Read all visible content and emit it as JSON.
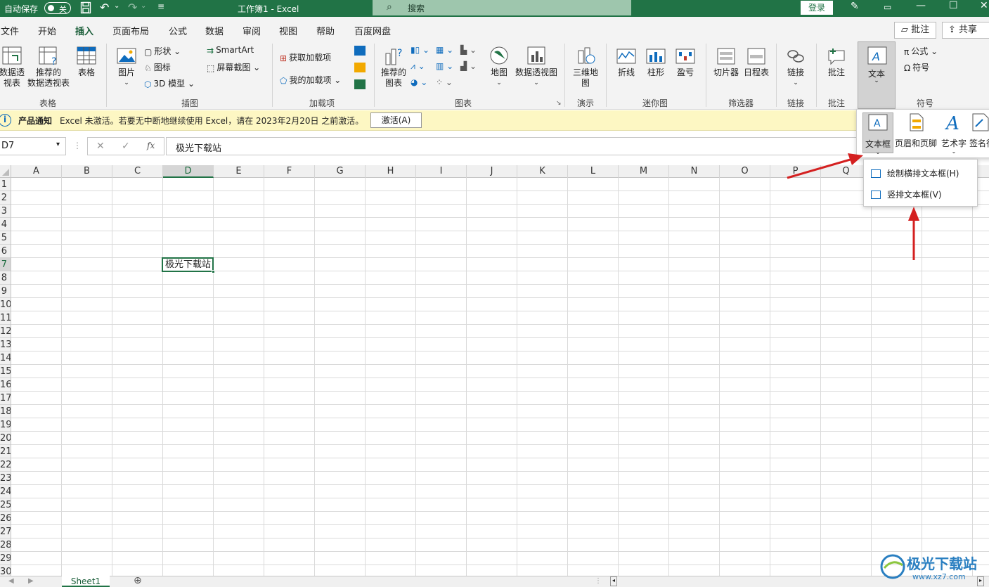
{
  "titlebar": {
    "autosave_label": "自动保存",
    "autosave_state": "关",
    "doc_title": "工作簿1  -  Excel",
    "search_placeholder": "搜索",
    "login_label": "登录",
    "bg_color": "#217346"
  },
  "menu": {
    "items": [
      "文件",
      "开始",
      "插入",
      "页面布局",
      "公式",
      "数据",
      "审阅",
      "视图",
      "帮助",
      "百度网盘"
    ],
    "active": "插入",
    "comment_label": "批注",
    "share_label": "共享"
  },
  "ribbon": {
    "table_group": {
      "pivot_label_1": "数据透",
      "pivot_label_2": "视表",
      "recommended_label_1": "推荐的",
      "recommended_label_2": "数据透视表",
      "table_label": "表格",
      "group_label": "表格"
    },
    "illustrations": {
      "picture_label": "图片",
      "shapes_label": "形状",
      "icons_label": "图标",
      "model3d_label": "3D 模型",
      "smartart_label": "SmartArt",
      "screenshot_label": "屏幕截图",
      "group_label": "插图"
    },
    "addins": {
      "get_label": "获取加载项",
      "my_label": "我的加载项",
      "group_label": "加载项"
    },
    "charts": {
      "recommended_label_1": "推荐的",
      "recommended_label_2": "图表",
      "map_label": "地图",
      "pivotchart_label": "数据透视图",
      "group_label": "图表"
    },
    "tours": {
      "label_1": "三维地",
      "label_2": "图",
      "group_label": "演示"
    },
    "sparklines": {
      "line_label": "折线",
      "column_label": "柱形",
      "winloss_label": "盈亏",
      "group_label": "迷你图"
    },
    "filters": {
      "slicer_label": "切片器",
      "timeline_label": "日程表",
      "group_label": "筛选器"
    },
    "links": {
      "link_label": "链接",
      "group_label": "链接"
    },
    "comments": {
      "comment_label": "批注",
      "group_label": "批注"
    },
    "text": {
      "text_label": "文本"
    },
    "symbols": {
      "equation_label": "公式",
      "symbol_label": "符号",
      "group_label": "符号"
    }
  },
  "notify": {
    "title": "产品通知",
    "message": "Excel 未激活。若要无中断地继续使用 Excel，请在 2023年2月20日 之前激活。",
    "button": "激活(A)"
  },
  "formula_bar": {
    "name_box": "D7",
    "value": "极光下载站"
  },
  "grid": {
    "columns": [
      "A",
      "B",
      "C",
      "D",
      "E",
      "F",
      "G",
      "H",
      "I",
      "J",
      "K",
      "L",
      "M",
      "N",
      "O",
      "P",
      "Q"
    ],
    "rows": [
      "1",
      "2",
      "3",
      "4",
      "5",
      "6",
      "7",
      "8",
      "9",
      "10",
      "11",
      "12",
      "13",
      "14",
      "15",
      "16",
      "17",
      "18",
      "19",
      "20",
      "21",
      "22",
      "23",
      "24",
      "25",
      "26",
      "27",
      "28",
      "29",
      "30"
    ],
    "selected_column": "D",
    "selected_row": "7",
    "active_cell_text": "极光下载站"
  },
  "text_panel": {
    "items": [
      "文本框",
      "页眉和页脚",
      "艺术字",
      "签名行"
    ]
  },
  "textbox_menu": {
    "items": [
      "绘制横排文本框(H)",
      "竖排文本框(V)"
    ]
  },
  "sheet": {
    "tab_label": "Sheet1"
  },
  "watermark": {
    "text": "极光下载站",
    "url": "www.xz7.com"
  }
}
